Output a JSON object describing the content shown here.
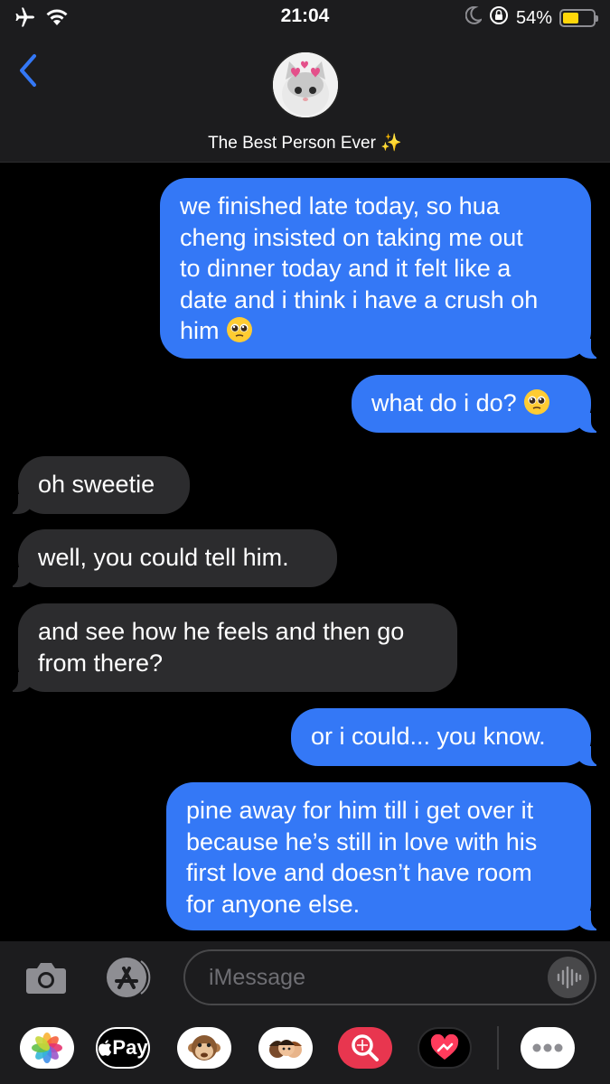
{
  "status_bar": {
    "time": "21:04",
    "battery_percent": "54%",
    "battery_level": 0.54,
    "icons": [
      "airplane-icon",
      "wifi-icon",
      "moon-icon",
      "orientation-lock-icon",
      "battery-icon"
    ]
  },
  "header": {
    "contact_name": "The Best Person Ever",
    "contact_emoji": "✨",
    "accent_color": "#3478f6"
  },
  "messages": [
    {
      "direction": "out",
      "lines": [
        "we finished late today, so hua",
        "cheng insisted on taking me out",
        "to dinner today and it felt like a",
        "date and i think i have a crush oh",
        "him"
      ],
      "emoji": "pleading-face"
    },
    {
      "direction": "out",
      "lines": [
        "what do i do?"
      ],
      "emoji": "pleading-face"
    },
    {
      "direction": "in",
      "lines": [
        "oh sweetie"
      ]
    },
    {
      "direction": "in",
      "lines": [
        "well, you could tell him."
      ]
    },
    {
      "direction": "in",
      "lines": [
        "and see how he feels and then go",
        "from there?"
      ]
    },
    {
      "direction": "out",
      "lines": [
        "or i could... you know."
      ]
    },
    {
      "direction": "out",
      "lines": [
        "pine away for him till i get over it",
        "because he’s still in love with his",
        "first love and doesn’t have room",
        "for anyone else."
      ]
    }
  ],
  "input": {
    "placeholder": "iMessage"
  },
  "app_drawer": {
    "apple_pay_label": "Pay",
    "apps": [
      "photos-app-icon",
      "apple-pay-app-icon",
      "animoji-app-icon",
      "memoji-app-icon",
      "image-search-app-icon",
      "digital-touch-app-icon",
      "more-apps-icon"
    ]
  },
  "colors": {
    "outgoing_bubble": "#3478f6",
    "incoming_bubble": "#2c2c2e",
    "background": "#000000",
    "bar_background": "#1c1c1e"
  }
}
